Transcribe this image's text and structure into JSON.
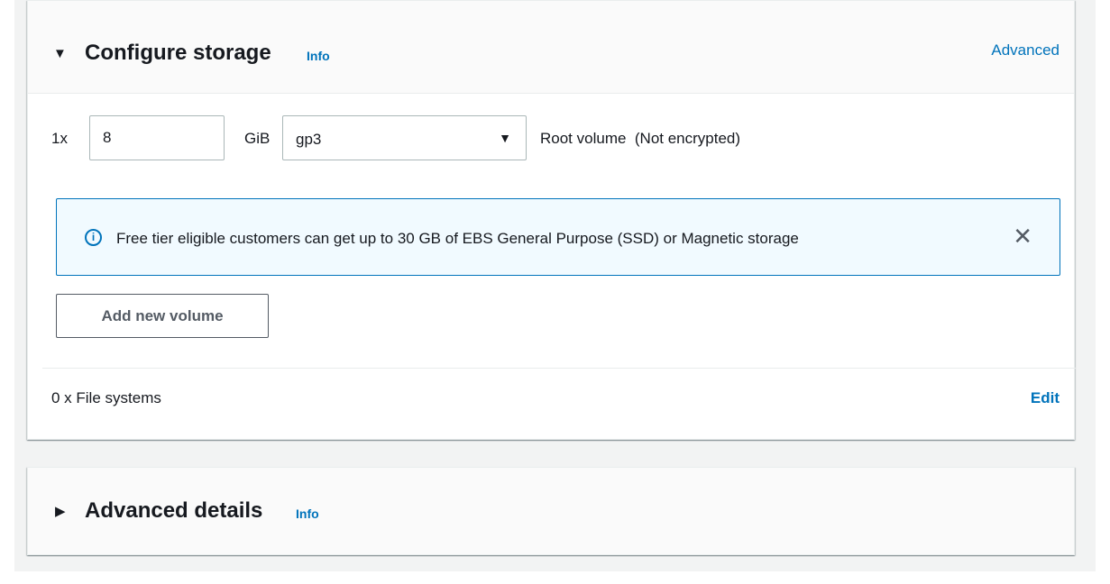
{
  "storage": {
    "title": "Configure storage",
    "info_label": "Info",
    "advanced_label": "Advanced",
    "volume": {
      "count_label": "1x",
      "size_value": "8",
      "unit_label": "GiB",
      "type_value": "gp3",
      "description": "Root volume  (Not encrypted)"
    },
    "alert": {
      "icon": "info-circle-icon",
      "text": "Free tier eligible customers can get up to 30 GB of EBS General Purpose (SSD) or Magnetic storage"
    },
    "add_volume_label": "Add new volume",
    "file_systems_label": "0 x File systems",
    "edit_label": "Edit"
  },
  "advanced_details": {
    "title": "Advanced details",
    "info_label": "Info"
  },
  "colors": {
    "link": "#0073bb",
    "alert_bg": "#f1faff",
    "alert_border": "#0073bb",
    "page_bg": "#f2f3f3"
  }
}
